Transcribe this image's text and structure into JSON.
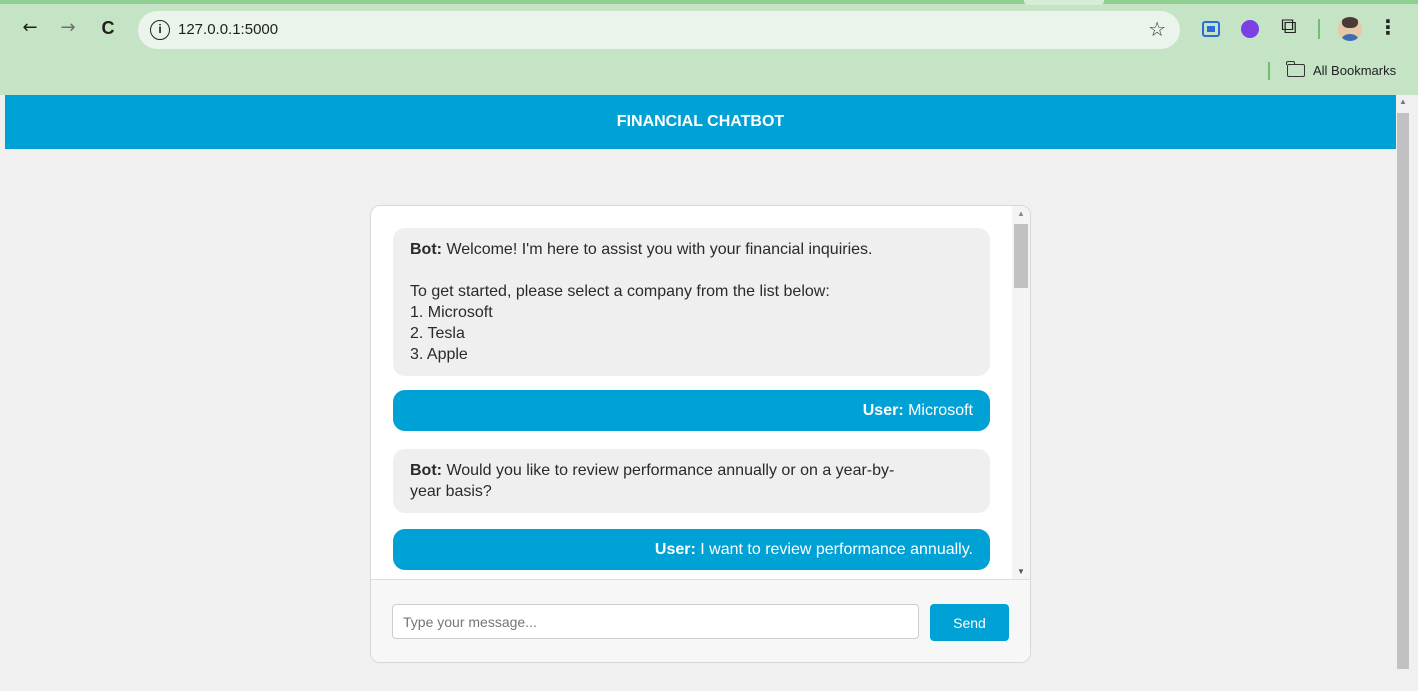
{
  "browser": {
    "url": "127.0.0.1:5000",
    "bookmarks_label": "All Bookmarks",
    "icons": {
      "back": "←",
      "forward": "→",
      "reload": "C",
      "info": "i",
      "star": "☆",
      "puzzle": "⧉",
      "menu": "⋮"
    }
  },
  "app": {
    "title": "FINANCIAL CHATBOT"
  },
  "chat": {
    "messages": [
      {
        "speaker": "Bot:",
        "lines": [
          "Welcome! I'm here to assist you with your financial inquiries."
        ],
        "lines2": [
          "To get started, please select a company from the list below:",
          "1. Microsoft",
          "2. Tesla",
          "3. Apple"
        ]
      },
      {
        "speaker": "User:",
        "text": "Microsoft"
      },
      {
        "speaker": "Bot:",
        "lines": [
          "Would you like to review performance annually or on a year-by-",
          "year basis?"
        ]
      },
      {
        "speaker": "User:",
        "text": "I want to review performance annually."
      }
    ],
    "input_placeholder": "Type your message...",
    "send_label": "Send"
  },
  "colors": {
    "accent": "#00a2d5",
    "chrome_bg": "#c5e3c5",
    "bot_bubble": "#efefef"
  }
}
